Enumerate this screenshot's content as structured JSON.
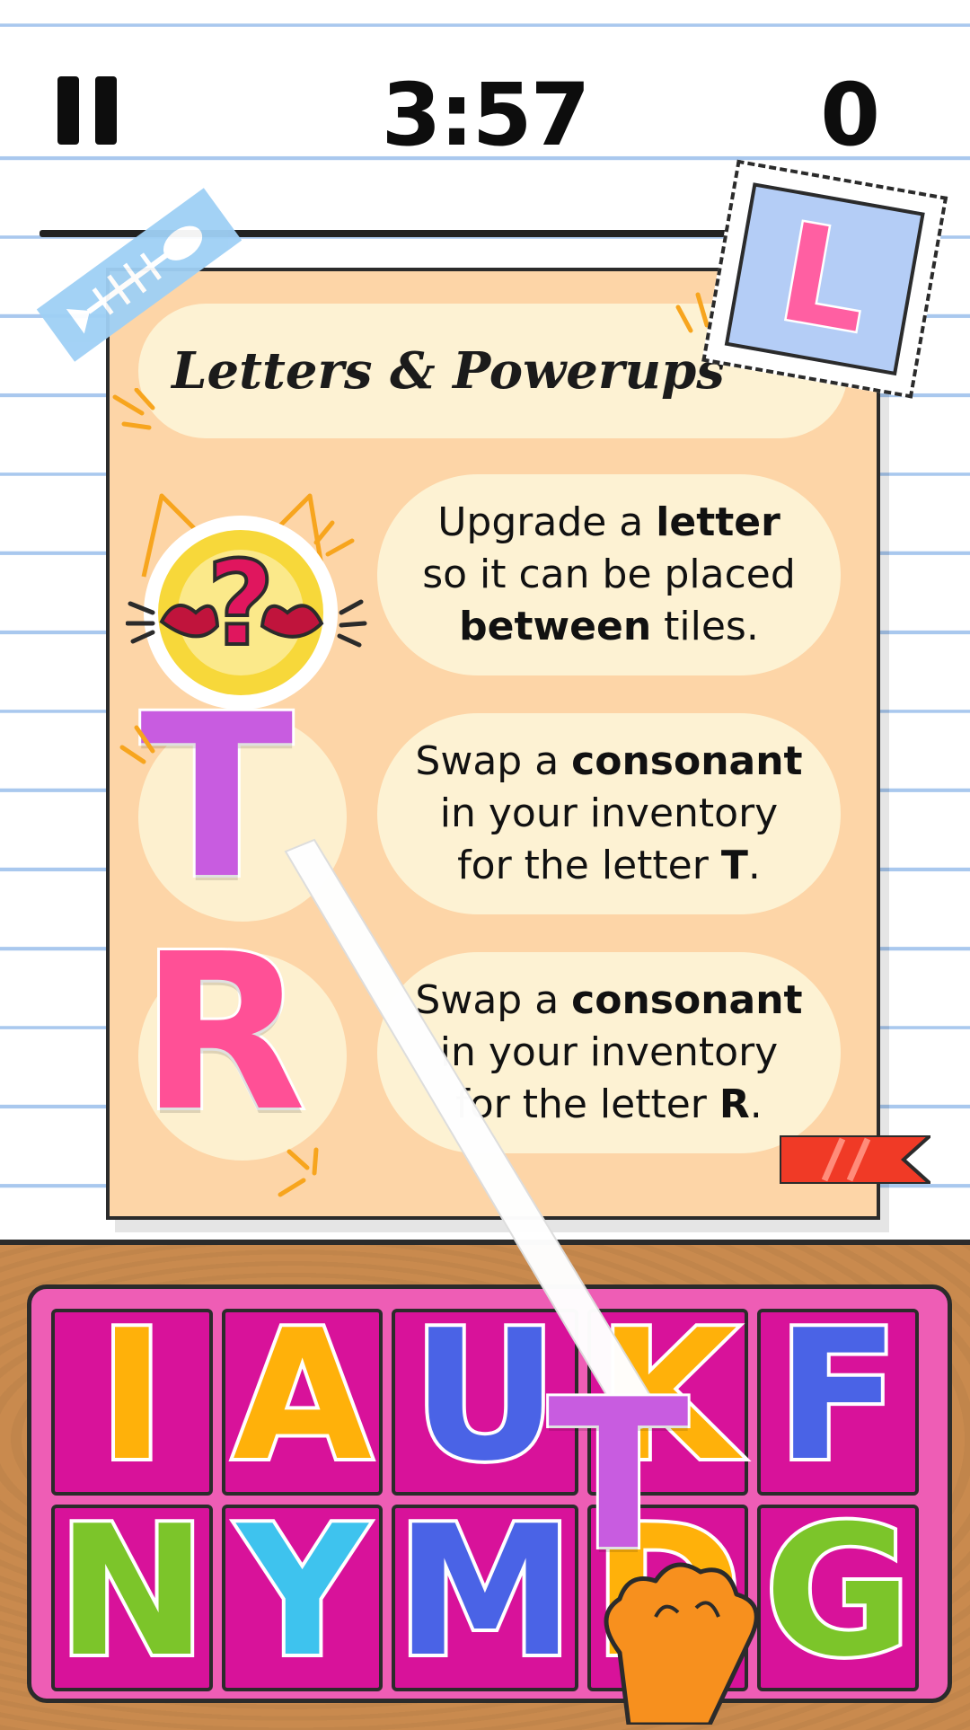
{
  "hud": {
    "timer": "3:57",
    "score": "0"
  },
  "card": {
    "title": "Letters & Powerups",
    "rows": [
      {
        "icon": "cat-question-icon",
        "parts": [
          {
            "t": "Upgrade a "
          },
          {
            "t": "letter",
            "b": true
          },
          {
            "br": true
          },
          {
            "t": "so it can be placed"
          },
          {
            "br": true
          },
          {
            "t": "between",
            "b": true
          },
          {
            "t": " tiles."
          }
        ]
      },
      {
        "icon": "letter-T",
        "letter": "T",
        "parts": [
          {
            "t": "Swap a "
          },
          {
            "t": "consonant",
            "b": true
          },
          {
            "br": true
          },
          {
            "t": "in your inventory"
          },
          {
            "br": true
          },
          {
            "t": "for the letter "
          },
          {
            "t": "T",
            "b": true
          },
          {
            "t": "."
          }
        ]
      },
      {
        "icon": "letter-R",
        "letter": "R",
        "parts": [
          {
            "t": "Swap a "
          },
          {
            "t": "consonant",
            "b": true
          },
          {
            "br": true
          },
          {
            "t": "in your inventory"
          },
          {
            "br": true
          },
          {
            "t": "for the letter "
          },
          {
            "t": "R",
            "b": true
          },
          {
            "t": "."
          }
        ]
      }
    ]
  },
  "stamp": {
    "letter": "L"
  },
  "tray": {
    "tiles": [
      {
        "letter": "I",
        "color": "#ffb10a"
      },
      {
        "letter": "A",
        "color": "#ffb10a"
      },
      {
        "letter": "U",
        "color": "#4a63e6"
      },
      {
        "letter": "K",
        "color": "#ffb10a"
      },
      {
        "letter": "F",
        "color": "#4a63e6"
      },
      {
        "letter": "N",
        "color": "#7cc52a"
      },
      {
        "letter": "Y",
        "color": "#3ec3ee"
      },
      {
        "letter": "M",
        "color": "#4a63e6"
      },
      {
        "letter": "D",
        "color": "#ffb10a"
      },
      {
        "letter": "G",
        "color": "#7cc52a"
      }
    ]
  },
  "dragged_tile": {
    "letter": "T",
    "color": "#c85ce0"
  },
  "colors": {
    "T": "#c85ce0",
    "R": "#ff5096",
    "accent_orange": "#f7901e",
    "ribbon": "#f03a26"
  }
}
